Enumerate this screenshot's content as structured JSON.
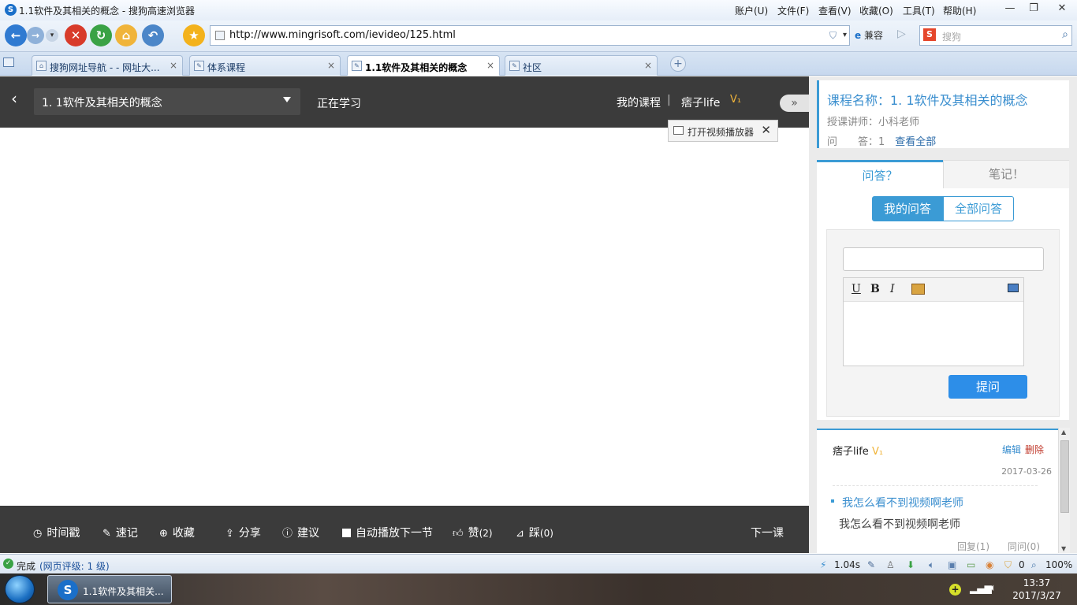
{
  "window": {
    "title": "1.1软件及其相关的概念 - 搜狗高速浏览器",
    "menus": [
      "账户(U)",
      "文件(F)",
      "查看(V)",
      "收藏(O)",
      "工具(T)",
      "帮助(H)"
    ]
  },
  "nav": {
    "url": "http://www.mingrisoft.com/ievideo/125.html",
    "compat_label": "兼容",
    "search_placeholder": "搜狗"
  },
  "tabs": [
    {
      "label": "搜狗网址导航 - - 网址大...",
      "active": false
    },
    {
      "label": "体系课程",
      "active": false
    },
    {
      "label": "1.1软件及其相关的概念",
      "active": true
    },
    {
      "label": "社区",
      "active": false
    }
  ],
  "player": {
    "lesson_selected": "1. 1软件及其相关的概念",
    "status": "正在学习",
    "my_courses": "我的课程",
    "separator": "|",
    "username": "痞子life",
    "open_player_label": "打开视频播放器",
    "toolbar": {
      "timestamp": "时间戳",
      "quick_note": "速记",
      "favorite": "收藏",
      "share": "分享",
      "suggest": "建议",
      "autoplay": "自动播放下一节",
      "like": "赞",
      "like_count": "(2)",
      "dislike": "踩",
      "dislike_count": "(0)",
      "next": "下一课"
    }
  },
  "sidebar": {
    "course_name": "课程名称：1. 1软件及其相关的概念",
    "teacher": "授课讲师：小科老师",
    "qa_label": "问　　答：1",
    "view_all": "查看全部",
    "main_tabs": [
      "问答？",
      "笔记！"
    ],
    "sub_tabs": [
      "我的问答",
      "全部问答"
    ],
    "submit": "提问",
    "post": {
      "user": "痞子life",
      "edit": "编辑",
      "delete": "删除",
      "date": "2017-03-26",
      "question": "我怎么看不到视频啊老师",
      "body": "我怎么看不到视频啊老师",
      "replies": "回复(1)",
      "same_question": "同问(0)"
    }
  },
  "statusbar": {
    "done": "完成",
    "rating": "(网页评级: 1 级)",
    "speed": "1.04s",
    "count": "0",
    "zoom": "100%"
  },
  "taskbar": {
    "item": "1.1软件及其相关...",
    "time": "13:37",
    "date": "2017/3/27"
  },
  "colors": {
    "accent": "#3b9bd5",
    "dark_bar": "#3b3b3b",
    "submit": "#2d8ee8"
  }
}
